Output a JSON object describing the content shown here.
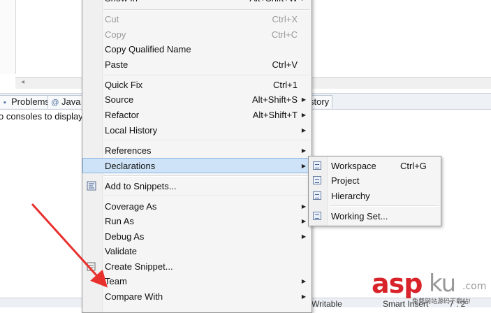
{
  "background": {
    "tabs": [
      {
        "icon": "problems-icon",
        "label": "Problems"
      },
      {
        "icon": "javadoc-icon",
        "label": "Java"
      },
      {
        "label": "story"
      }
    ],
    "console_message": "o consoles to display",
    "status": {
      "writable": "Writable",
      "insert_mode": "Smart Insert",
      "position": "7 : 2"
    }
  },
  "menu": {
    "items": [
      {
        "label": "Show In",
        "shortcut": "Alt+Shift+W",
        "submenu": true,
        "disabled": false
      },
      {
        "label": "Cut",
        "shortcut": "Ctrl+X",
        "disabled": true
      },
      {
        "label": "Copy",
        "shortcut": "Ctrl+C",
        "disabled": true
      },
      {
        "label": "Copy Qualified Name",
        "shortcut": "",
        "disabled": false
      },
      {
        "label": "Paste",
        "shortcut": "Ctrl+V",
        "disabled": false
      },
      {
        "label": "Quick Fix",
        "shortcut": "Ctrl+1",
        "disabled": false
      },
      {
        "label": "Source",
        "shortcut": "Alt+Shift+S",
        "submenu": true
      },
      {
        "label": "Refactor",
        "shortcut": "Alt+Shift+T",
        "submenu": true
      },
      {
        "label": "Local History",
        "submenu": true
      },
      {
        "label": "References",
        "submenu": true
      },
      {
        "label": "Declarations",
        "submenu": true,
        "highlighted": true
      },
      {
        "label": "Add to Snippets...",
        "icon": "snippets-icon"
      },
      {
        "label": "Coverage As",
        "submenu": true
      },
      {
        "label": "Run As",
        "submenu": true
      },
      {
        "label": "Debug As",
        "submenu": true
      },
      {
        "label": "Validate"
      },
      {
        "label": "Create Snippet...",
        "icon": "snippet-create-icon"
      },
      {
        "label": "Team",
        "submenu": true
      },
      {
        "label": "Compare With",
        "submenu": true
      }
    ]
  },
  "submenu": {
    "items": [
      {
        "label": "Workspace",
        "shortcut": "Ctrl+G"
      },
      {
        "label": "Project",
        "shortcut": ""
      },
      {
        "label": "Hierarchy",
        "shortcut": ""
      },
      {
        "label": "Working Set...",
        "shortcut": ""
      }
    ]
  },
  "watermark": {
    "brand_red": "asp",
    "brand_gray": "ku",
    "suffix": ".com",
    "tagline": "免费网站源码下载站!"
  },
  "colors": {
    "highlight": "#cfe3f8",
    "annotation_arrow": "#e8302d",
    "watermark_red": "#d8232a"
  }
}
